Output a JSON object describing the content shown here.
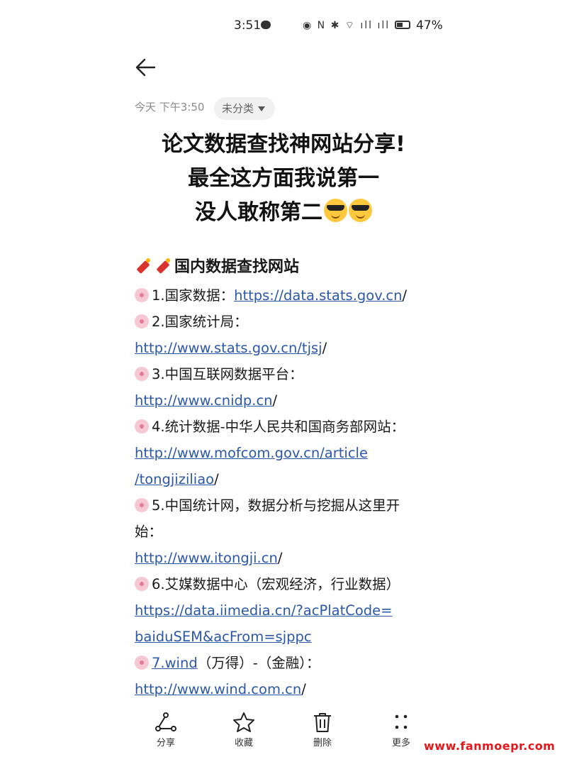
{
  "status_bar": {
    "time": "3:51",
    "icons": "◉ N ✱ ⌔ ıll ıll",
    "battery": "47%"
  },
  "note": {
    "date": "今天 下午3:50",
    "category": "未分类",
    "title_lines": [
      "论文数据查找神网站分享!",
      "最全这方面我说第一",
      "没人敢称第二"
    ],
    "heading": "国内数据查找网站",
    "items": [
      {
        "prefix": "1.国家数据：",
        "link": "https://data.stats.gov.cn",
        "suffix": "/"
      },
      {
        "prefix": "2.国家统计局："
      },
      {
        "link": "http://www.stats.gov.cn/tjsj",
        "suffix": "/"
      },
      {
        "prefix": "3.中国互联网数据平台："
      },
      {
        "link": "http://www.cnidp.cn",
        "suffix": "/"
      },
      {
        "prefix": "4.统计数据-中华人民共和国商务部网站："
      },
      {
        "link": "http://www.mofcom.gov.cn/article"
      },
      {
        "link": "/tongjiziliao",
        "suffix": "/"
      },
      {
        "prefix": "5.中国统计网，数据分析与挖掘从这里开"
      },
      {
        "text": "始："
      },
      {
        "link": "http://www.itongji.cn",
        "suffix": "/"
      },
      {
        "prefix": "6.艾媒数据中心（宏观经济，行业数据）"
      },
      {
        "link": "https://data.iimedia.cn/?acPlatCode="
      },
      {
        "link": "baiduSEM&acFrom=sjppc"
      },
      {
        "link": "7.wind",
        "suffix": "（万得）-（金融）："
      },
      {
        "link": "http://www.wind.com.cn",
        "suffix": "/"
      }
    ]
  },
  "toolbar": {
    "share": "分享",
    "favorite": "收藏",
    "delete": "删除",
    "more": "更多"
  },
  "watermark": "www.fanmoepr.com"
}
